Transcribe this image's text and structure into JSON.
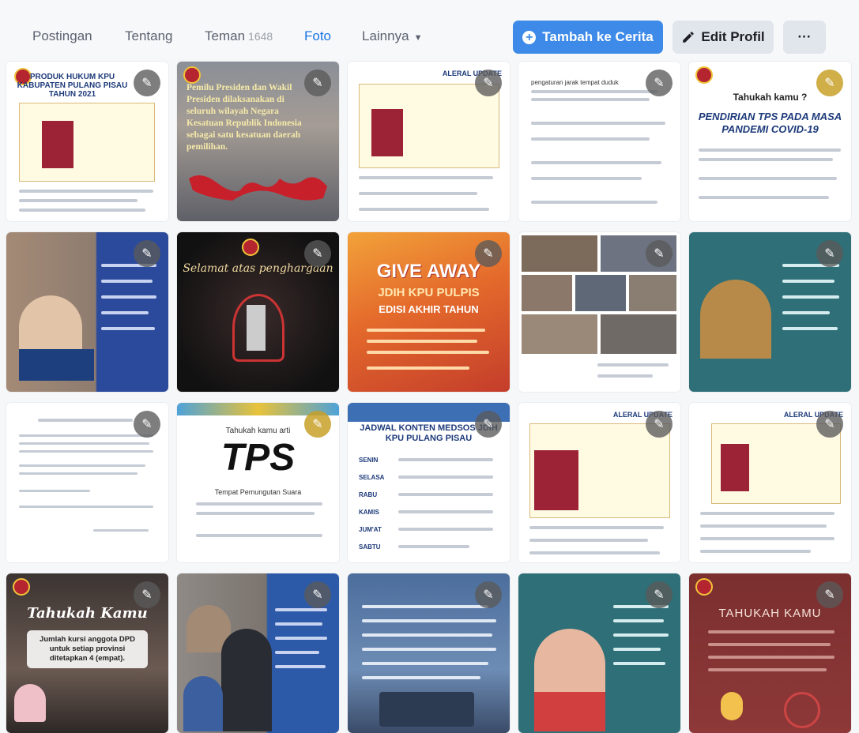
{
  "tabs": [
    {
      "label": "Postingan",
      "active": false
    },
    {
      "label": "Tentang",
      "active": false
    },
    {
      "label": "Teman",
      "count": "1648",
      "active": false
    },
    {
      "label": "Foto",
      "active": true
    },
    {
      "label": "Lainnya",
      "active": false
    }
  ],
  "actions": {
    "add_story": "Tambah ke Cerita",
    "edit_profile": "Edit Profil",
    "more": "···"
  },
  "colors": {
    "accent": "#1b74e4",
    "primary_button": "#3d8ae8"
  },
  "photos": [
    {
      "r1c1": "PRODUK HUKUM KPU KABUPATEN PULANG PISAU TAHUN 2021"
    },
    {
      "r1c2": "Pemilu Presiden dan Wakil Presiden dilaksanakan di seluruh wilayah Negara Kesatuan Republik Indonesia sebagai satu kesatuan daerah pemilihan."
    },
    {
      "r1c3": "ALERAL UPDATE"
    },
    {
      "r1c4": "pengaturan jarak tempat duduk"
    },
    {
      "r1c5_title": "Tahukah kamu ?",
      "r1c5_sub": "PENDIRIAN TPS PADA MASA PANDEMI COVID-19"
    },
    {
      "r2c2": "Selamat atas penghargaan"
    },
    {
      "r3c2_title": "TPS",
      "r3c2_sub": "Tahukah kamu arti",
      "r3c2_body": "Tempat Pemungutan Suara"
    },
    {
      "r3c3_title": "JADWAL KONTEN MEDSOS JDIH KPU PULANG PISAU",
      "r3c3_days": [
        "SENIN",
        "SELASA",
        "RABU",
        "KAMIS",
        "JUM'AT",
        "SABTU"
      ]
    },
    {
      "r3c4": "ALERAL UPDATE"
    },
    {
      "r3c5": "ALERAL UPDATE"
    },
    {
      "r4c1_title": "Tahukah Kamu",
      "r4c1_sub": "Jumlah kursi anggota DPD untuk setiap provinsi ditetapkan 4 (empat)."
    },
    {
      "r4c5": "TAHUKAH KAMU"
    }
  ],
  "giveaway": {
    "line1": "GIVE AWAY",
    "line2": "JDIH KPU PULPIS",
    "line3": "EDISI AKHIR TAHUN"
  },
  "icons": {
    "edit": "pencil-icon",
    "plus": "plus-circle-icon",
    "more": "more-icon"
  }
}
